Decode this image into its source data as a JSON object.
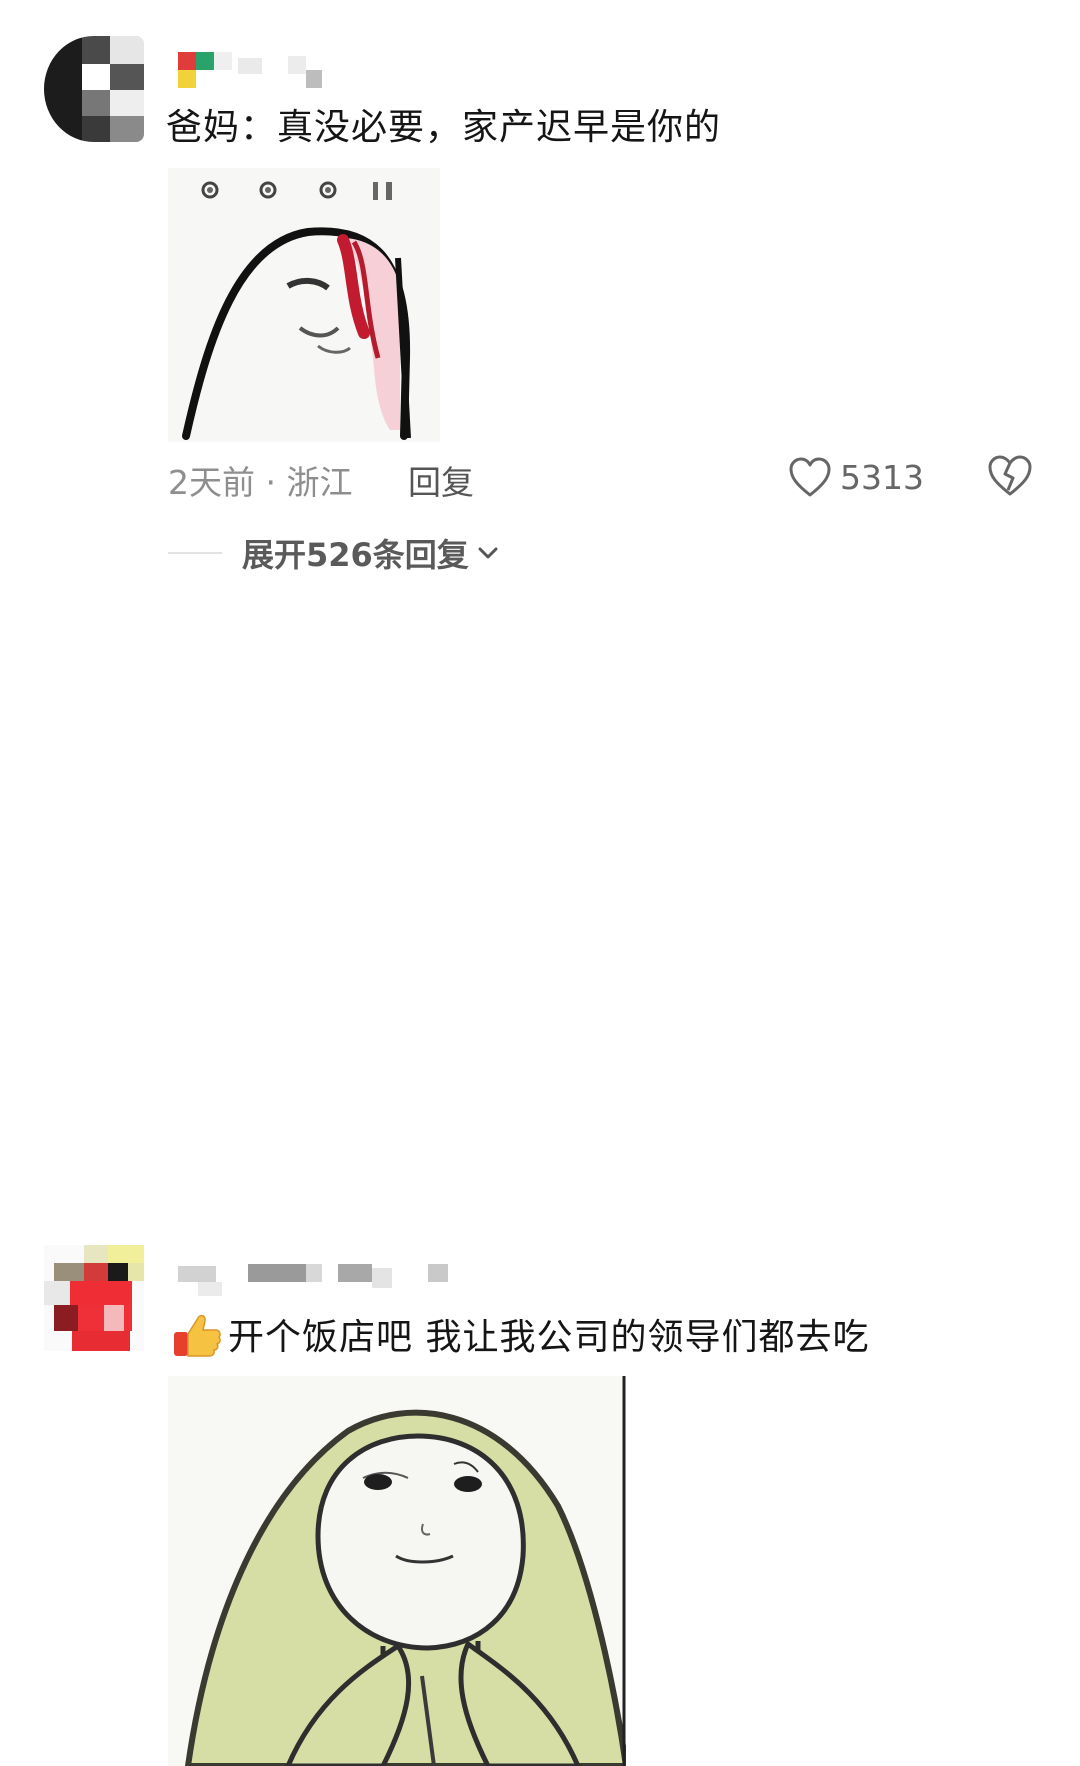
{
  "comments": [
    {
      "text": "爸妈：真没必要，家产迟早是你的",
      "time_location": "2天前 · 浙江",
      "reply_label": "回复",
      "like_count": "5313",
      "expand_label": "展开526条回复"
    },
    {
      "emoji": "thumbs-up-emoji",
      "text": "开个饭店吧 我让我公司的领导们都去吃"
    }
  ],
  "colors": {
    "text": "#151515",
    "meta": "#8e8e8e",
    "icon": "#666666"
  }
}
